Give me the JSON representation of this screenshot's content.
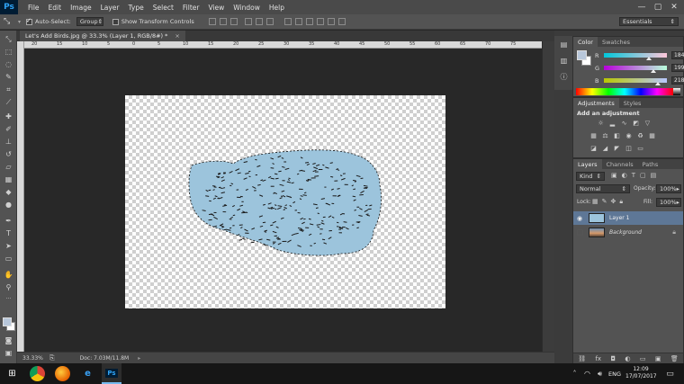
{
  "menubar": {
    "logo": "Ps",
    "items": [
      "File",
      "Edit",
      "Image",
      "Layer",
      "Type",
      "Select",
      "Filter",
      "View",
      "Window",
      "Help"
    ],
    "window_controls": [
      "—",
      "▢",
      "✕"
    ]
  },
  "options": {
    "auto_select_label": "Auto-Select:",
    "auto_select_checked": true,
    "auto_select_value": "Group",
    "show_transform_label": "Show Transform Controls",
    "show_transform_checked": false,
    "workspace_value": "Essentials"
  },
  "document": {
    "tab_title": "Let's Add Birds.jpg @ 33.3% (Layer 1, RGB/8#) *",
    "tab_close": "×",
    "ruler_ticks": [
      "20",
      "15",
      "10",
      "5",
      "0",
      "5",
      "10",
      "15",
      "20",
      "25",
      "30",
      "35",
      "40",
      "45",
      "50",
      "55",
      "60",
      "65",
      "70",
      "75"
    ],
    "zoom": "33.33%",
    "doc_info": "Doc: 7.03M/11.8M"
  },
  "color_panel": {
    "tabs": [
      "Color",
      "Swatches"
    ],
    "channels": [
      {
        "label": "R",
        "value": "184",
        "level": 0.72
      },
      {
        "label": "G",
        "value": "199",
        "level": 0.78
      },
      {
        "label": "B",
        "value": "218",
        "level": 0.85
      }
    ],
    "foreground": "#b8c7da"
  },
  "adjustments_panel": {
    "tabs": [
      "Adjustments",
      "Styles"
    ],
    "heading": "Add an adjustment"
  },
  "layers_panel": {
    "tabs": [
      "Layers",
      "Channels",
      "Paths"
    ],
    "filter_kind": "Kind",
    "blend_mode": "Normal",
    "opacity_label": "Opacity:",
    "opacity_value": "100%",
    "lock_label": "Lock:",
    "fill_label": "Fill:",
    "fill_value": "100%",
    "layers": [
      {
        "name": "Layer 1",
        "selected": true,
        "visible": true
      },
      {
        "name": "Background",
        "selected": false,
        "visible": false,
        "locked": true
      }
    ]
  },
  "taskbar": {
    "language": "ENG",
    "time": "12:09",
    "date": "17/07/2017"
  }
}
